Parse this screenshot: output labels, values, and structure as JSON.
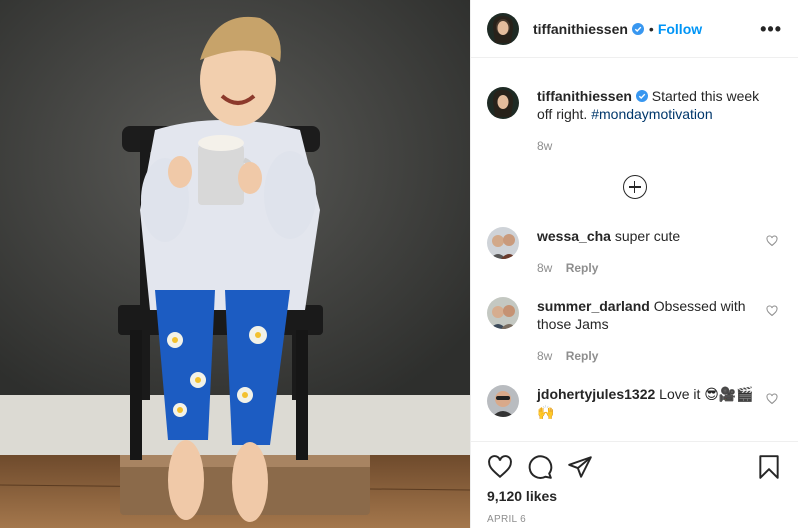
{
  "post": {
    "author": "tiffanithiessen",
    "follow_label": "Follow",
    "dot": "•",
    "more_label": "•••",
    "image_alt": "Child in a white robe and egg-and-bacon pajamas sitting on a black chair with a mug"
  },
  "caption": {
    "username": "tiffanithiessen",
    "text": "Started this week off right.",
    "hashtag": "#mondaymotivation",
    "time": "8w"
  },
  "comments": [
    {
      "username": "wessa_cha",
      "text": "super cute",
      "time": "8w",
      "reply": "Reply"
    },
    {
      "username": "summer_darland",
      "text": "Obsessed with those Jams",
      "time": "8w",
      "reply": "Reply"
    },
    {
      "username": "jdohertyjules1322",
      "text": "Love it 😎🎥🎬🙌"
    }
  ],
  "footer": {
    "likes": "9,120 likes",
    "date": "APRIL 6"
  },
  "colors": {
    "link_blue": "#0095f6",
    "hashtag": "#00376b",
    "muted": "#8e8e8e"
  },
  "icons": [
    "verified-badge-icon",
    "more-options-icon",
    "load-more-icon",
    "heart-icon",
    "comment-icon",
    "share-icon",
    "bookmark-icon"
  ]
}
